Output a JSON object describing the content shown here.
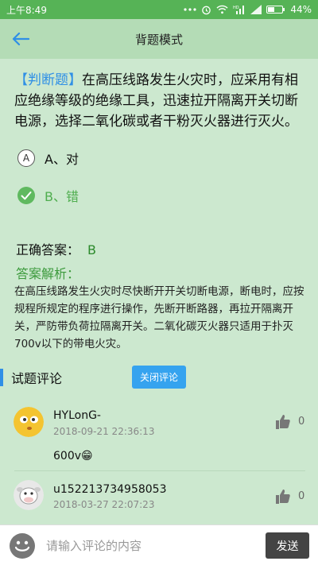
{
  "status_bar": {
    "time": "上午8:49",
    "battery": "44%"
  },
  "app_bar": {
    "title": "背题模式"
  },
  "question": {
    "tag": "【判断题】",
    "text": "在高压线路发生火灾时，应采用有相应绝缘等级的绝缘工具，迅速拉开隔离开关切断电源，选择二氧化碳或者干粉灭火器进行灭火。"
  },
  "options": [
    {
      "letter": "A",
      "label": "A、对"
    },
    {
      "letter": "B",
      "label": "B、错"
    }
  ],
  "answer": {
    "label": "正确答案：",
    "value": "B"
  },
  "analysis": {
    "title": "答案解析：",
    "text": "在高压线路发生火灾时尽快断开开关切断电源，断电时，应按规程所规定的程序进行操作，先断开断路器，再拉开隔离开关，严防带负荷拉隔离开关。二氧化碳灭火器只适用于扑灭700v以下的带电火灾。"
  },
  "comments_section": {
    "title": "试题评论",
    "close_label": "关闭评论"
  },
  "comments": [
    {
      "name": "HYLonG-",
      "date": "2018-09-21 22:36:13",
      "likes": "0",
      "text": "600v😁"
    },
    {
      "name": "u152213734958053",
      "date": "2018-03-27 22:07:23",
      "likes": "0"
    }
  ],
  "input_bar": {
    "placeholder": "请输入评论的内容",
    "send_label": "发送"
  },
  "colors": {
    "status_bar": "#56b356",
    "app_bar": "#b4dcb6",
    "background": "#cce8cf",
    "accent_blue": "#2f8fe6",
    "correct_green": "#4fae4f"
  }
}
